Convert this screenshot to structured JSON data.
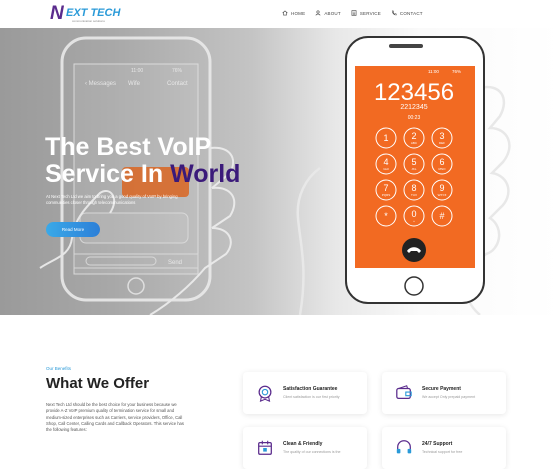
{
  "nav": {
    "logo_mark": "N",
    "logo_text": "EXT TECH",
    "logo_tagline": "communication solutions",
    "items": [
      {
        "label": "HOME",
        "icon": "home-icon"
      },
      {
        "label": "ABOUT",
        "icon": "user-icon"
      },
      {
        "label": "SERVICE",
        "icon": "list-icon"
      },
      {
        "label": "CONTACT",
        "icon": "phone-icon"
      }
    ]
  },
  "hero": {
    "title_line1": "The Best VoIP",
    "title_line2_prefix": "Service In ",
    "title_line2_highlight": "World",
    "subtitle": "At Next Tech Ltd we aim to bring you a good quality of VoIP by bringing communities closer through telecommunications",
    "button_label": "Read More",
    "phone_left": {
      "status_time": "11:00",
      "battery": "76%",
      "back_label": "Messages",
      "contact_label": "Contact",
      "center_label": "Wife",
      "send_label": "Send"
    },
    "phone_right": {
      "status_time": "11:00",
      "battery": "76%",
      "dialed_number": "123456",
      "sub_number": "2212345",
      "call_time": "00:23",
      "keys": [
        {
          "digit": "1",
          "letters": ""
        },
        {
          "digit": "2",
          "letters": "ABC"
        },
        {
          "digit": "3",
          "letters": "DEF"
        },
        {
          "digit": "4",
          "letters": "GHI"
        },
        {
          "digit": "5",
          "letters": "JKL"
        },
        {
          "digit": "6",
          "letters": "MNO"
        },
        {
          "digit": "7",
          "letters": "PQRS"
        },
        {
          "digit": "8",
          "letters": "TUV"
        },
        {
          "digit": "9",
          "letters": "WXYZ"
        },
        {
          "digit": "*",
          "letters": ""
        },
        {
          "digit": "0",
          "letters": "+"
        },
        {
          "digit": "#",
          "letters": ""
        }
      ],
      "screen_color": "#f26a22"
    }
  },
  "offer": {
    "eyebrow": "Our Benefits",
    "heading": "What We Offer",
    "description": "Next Tech Ltd should be the best choice for your business because we provide A-Z VoIP premium quality of termination service for small and medium-sized enterprises such as Carriers, service providers, Office, Call Shop, Call Center, Calling Cards and Callback Operators. This service has the following features:",
    "cards": [
      {
        "title": "Satisfaction Guarantee",
        "subtitle": "Client satisfaction is our first priority",
        "icon": "badge-icon"
      },
      {
        "title": "Secure Payment",
        "subtitle": "We accept Only prepaid payment",
        "icon": "wallet-icon"
      },
      {
        "title": "Clean & Friendly",
        "subtitle": "The quality of our connections is the",
        "icon": "calendar-icon"
      },
      {
        "title": "24/7 Support",
        "subtitle": "Technical support for free",
        "icon": "support-icon"
      }
    ]
  },
  "colors": {
    "accent": "#2a9ad8",
    "brand": "#5b2c8d",
    "dialer_orange": "#f26a22"
  }
}
